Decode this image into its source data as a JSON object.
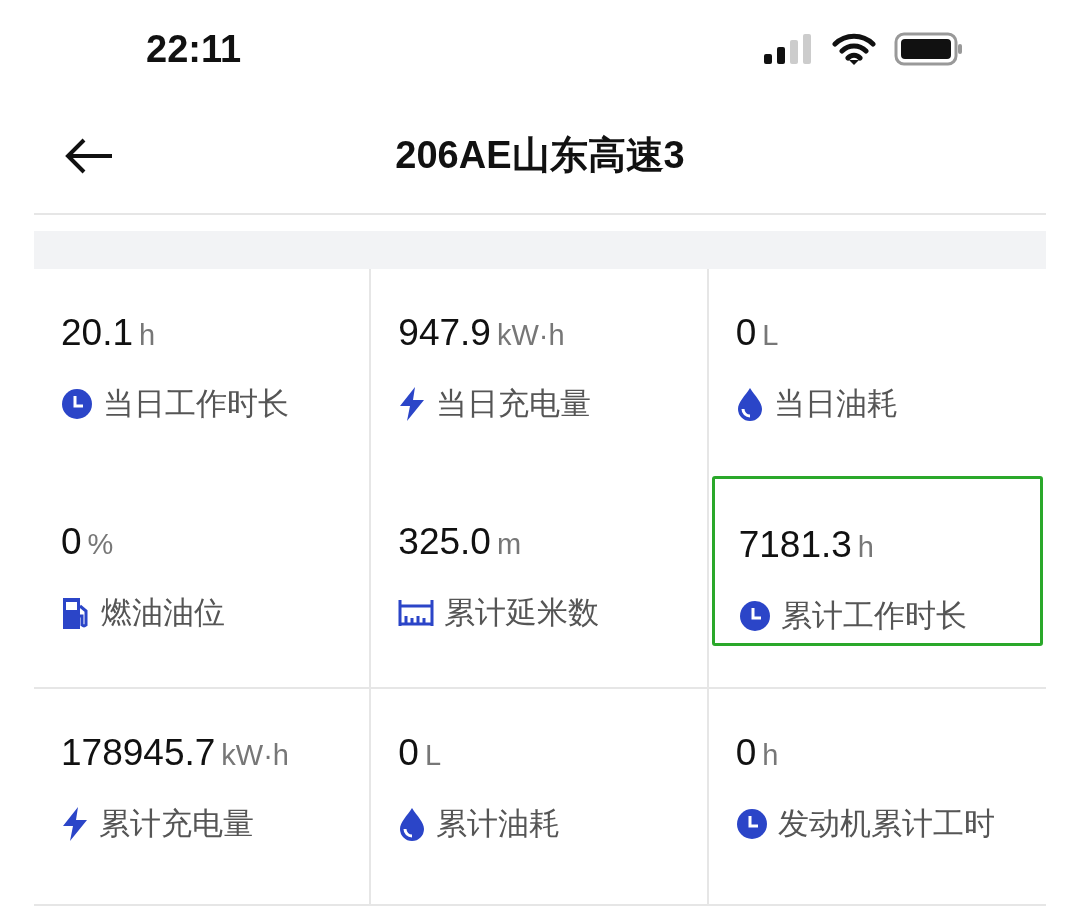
{
  "status_bar": {
    "time": "22:11"
  },
  "header": {
    "title": "206AE山东高速3"
  },
  "metrics": [
    {
      "value": "20.1",
      "unit": "h",
      "label": "当日工作时长",
      "kind": "clock",
      "selected": false
    },
    {
      "value": "947.9",
      "unit": "kW·h",
      "label": "当日充电量",
      "kind": "bolt",
      "selected": false
    },
    {
      "value": "0",
      "unit": "L",
      "label": "当日油耗",
      "kind": "drop",
      "selected": false
    },
    {
      "value": "0",
      "unit": "%",
      "label": "燃油油位",
      "kind": "fuel",
      "selected": false
    },
    {
      "value": "325.0",
      "unit": "m",
      "label": "累计延米数",
      "kind": "ruler",
      "selected": false
    },
    {
      "value": "7181.3",
      "unit": "h",
      "label": "累计工作时长",
      "kind": "clock",
      "selected": true
    },
    {
      "value": "178945.7",
      "unit": "kW·h",
      "label": "累计充电量",
      "kind": "bolt",
      "selected": false
    },
    {
      "value": "0",
      "unit": "L",
      "label": "累计油耗",
      "kind": "drop",
      "selected": false
    },
    {
      "value": "0",
      "unit": "h",
      "label": "发动机累计工时",
      "kind": "clock",
      "selected": false
    }
  ]
}
